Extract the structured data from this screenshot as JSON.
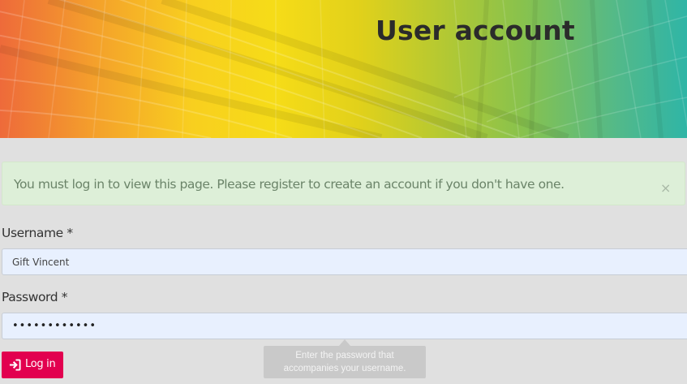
{
  "header": {
    "title": "User account"
  },
  "alert": {
    "message": "You must log in to view this page. Please register to create an account if you don't have one.",
    "close_glyph": "×"
  },
  "form": {
    "username": {
      "label": "Username *",
      "value": "Gift Vincent"
    },
    "password": {
      "label": "Password *",
      "value": "••••••••••••"
    },
    "tooltip": {
      "line1": "Enter the password that",
      "line2": "accompanies your username."
    },
    "login_button": {
      "label": "Log in",
      "icon": "sign-in-icon"
    }
  },
  "colors": {
    "accent": "#e2004f",
    "alert_bg": "#ddefd8",
    "alert_text": "#6b8469",
    "input_bg": "#e8f0fe",
    "page_bg": "#e0e0e0"
  }
}
